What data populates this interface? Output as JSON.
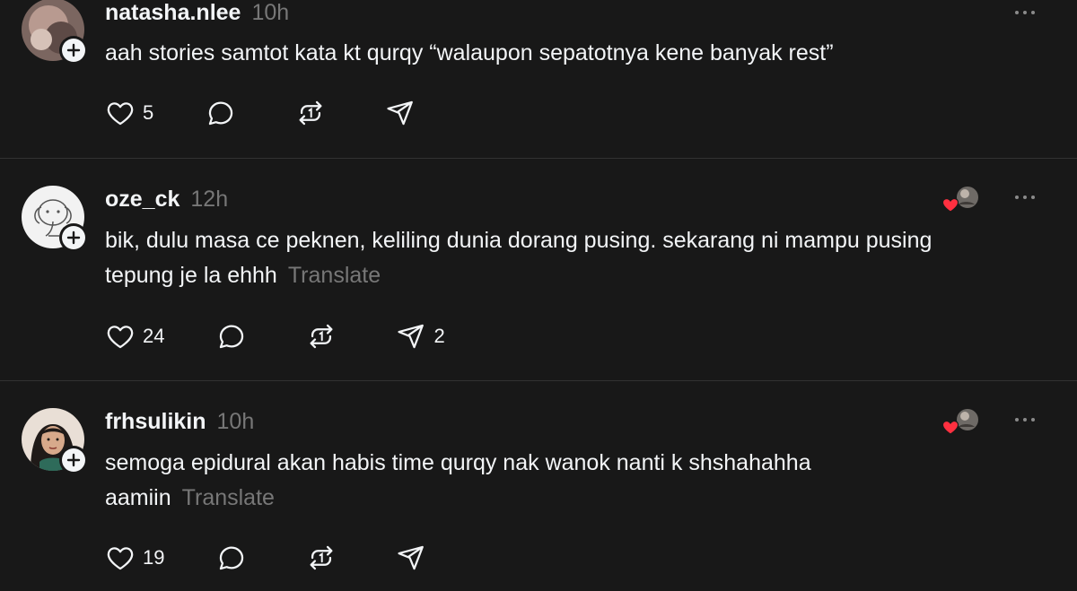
{
  "posts": [
    {
      "username": "natasha.nlee",
      "time": "10h",
      "text": "aah stories samtot kata kt qurqy “walaupon sepatotnya kene banyak rest”",
      "translate": "",
      "likes": "5",
      "comments": "",
      "reposts": "",
      "shares": ""
    },
    {
      "username": "oze_ck",
      "time": "12h",
      "text": "bik, dulu masa ce peknen, keliling dunia dorang pusing. sekarang ni mampu pusing tepung je la ehhh",
      "translate": "Translate",
      "likes": "24",
      "comments": "",
      "reposts": "",
      "shares": "2"
    },
    {
      "username": "frhsulikin",
      "time": "10h",
      "text": "semoga epidural akan habis time qurqy nak wanok nanti k shshahahha aamiin",
      "translate": "Translate",
      "likes": "19",
      "comments": "",
      "reposts": "",
      "shares": ""
    }
  ],
  "colors": {
    "background": "#181818",
    "text": "#f3f5f7",
    "muted": "#777777",
    "divider": "#323232",
    "heart_red": "#ff3040"
  },
  "icons": {
    "like": "heart-icon",
    "comment": "comment-bubble-icon",
    "repost": "repost-icon",
    "share": "send-icon",
    "follow": "plus-icon",
    "more": "ellipsis-icon"
  }
}
